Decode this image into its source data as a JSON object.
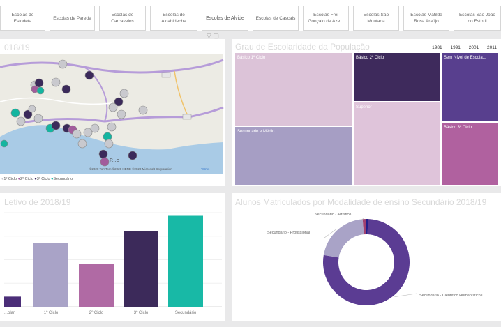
{
  "tabs": [
    "Escolas de Estodeta",
    "Escolas de Parede",
    "Escolas de Carcavelos",
    "Escolas de Alcabideche",
    "Escolas de Alvide",
    "Escolas de Cascais",
    "Escolas Frei Gonçalo de Aze...",
    "Escolas São Moutana",
    "Escolas Matilde Rosa Araújo",
    "Escolas São João do Estoril"
  ],
  "map": {
    "title_fragment": "018/19",
    "town_label": "P...e",
    "attribution": "©2020 TomTom ©2020 HERE ©2020 Microsoft Corporation",
    "attribution_link": "Terms",
    "legend": [
      {
        "label": "1º Ciclo",
        "color": "#c9c9ce"
      },
      {
        "label": "2º Ciclo",
        "color": "#a25c9c"
      },
      {
        "label": "3º Ciclo",
        "color": "#3b2a5a"
      },
      {
        "label": "Secundário",
        "color": "#14b5a0"
      }
    ]
  },
  "treemap": {
    "title": "Grau de Escolaridade da População",
    "years": [
      "1981",
      "1991",
      "2001",
      "2011"
    ],
    "cells": [
      {
        "label": "Básico 1º Ciclo",
        "color": "#dcc3d8"
      },
      {
        "label": "Básico 2º Ciclo",
        "color": "#3e2a5c"
      },
      {
        "label": "Sem Nível de Escola...",
        "color": "#583f8e"
      },
      {
        "label": "Secundário e Médio",
        "color": "#a69ec4"
      },
      {
        "label": "Superior",
        "color": "#dfc4da"
      },
      {
        "label": "Básico 3º Ciclo",
        "color": "#b0619f"
      }
    ]
  },
  "bar_panel": {
    "title_fragment": "Letivo de 2018/19"
  },
  "donut_panel": {
    "title": "Alunos Matriculados por Modalidade de ensino Secundário  2018/19"
  },
  "chart_data": [
    {
      "type": "bar",
      "categories": [
        "...olar",
        "1º Ciclo",
        "2º Ciclo",
        "3º Ciclo",
        "Secundário"
      ],
      "values": [
        1.3,
        8.1,
        5.5,
        9.6,
        11.6
      ],
      "colors": [
        "#4b2e78",
        "#a9a3c7",
        "#b06aa4",
        "#3c2a5a",
        "#18b9a6"
      ],
      "ylim": [
        0,
        12
      ],
      "grid": true
    },
    {
      "type": "pie",
      "donut": true,
      "categories": [
        "Secundário - Artístico",
        "Secundário - Profissional",
        "Secundário - Científico Humanísticos"
      ],
      "values": [
        2,
        21,
        77
      ],
      "colors": [
        "#a0406f",
        "#a9a3c7",
        "#5b3c93"
      ],
      "extra_slice_color": "#24208a"
    }
  ]
}
